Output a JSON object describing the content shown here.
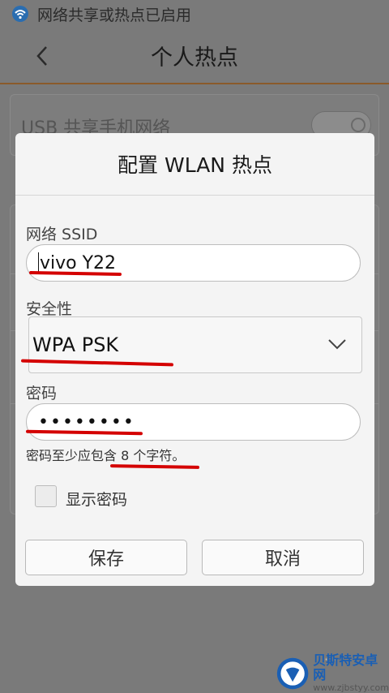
{
  "statusbar": {
    "text": "网络共享或热点已启用",
    "icon": "wifi-hotspot-icon"
  },
  "header": {
    "title": "个人热点",
    "back_icon": "chevron-left-icon"
  },
  "background": {
    "usb_label": "USB 共享手机网络",
    "usb_toggle_on": false
  },
  "dialog": {
    "title": "配置 WLAN 热点",
    "ssid_label": "网络 SSID",
    "ssid_value": "vivo Y22",
    "security_label": "安全性",
    "security_value": "WPA PSK",
    "password_label": "密码",
    "password_value": "••••••••",
    "password_hint": "密码至少应包含 8 个字符。",
    "show_password_label": "显示密码",
    "show_password_checked": false,
    "save_label": "保存",
    "cancel_label": "取消"
  },
  "watermark": {
    "name": "贝斯特安卓网",
    "url": "www.zjbstyy.com",
    "dots": "· ·"
  },
  "colors": {
    "accent": "#8a5a2a",
    "annotation": "#d40000",
    "brand": "#1a5fb4"
  }
}
